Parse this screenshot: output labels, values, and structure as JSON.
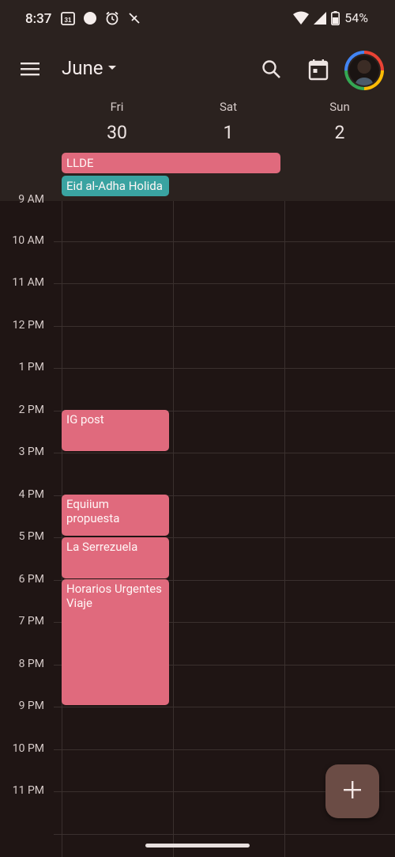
{
  "status_bar": {
    "time": "8:37",
    "calendar_icon_text": "31",
    "battery_text": "54%",
    "icons": [
      "calendar-icon",
      "dot-icon",
      "alarm-icon",
      "nfc-off-icon",
      "wifi-icon",
      "signal-icon",
      "battery-icon"
    ]
  },
  "header": {
    "month": "June",
    "icons": [
      "menu-icon",
      "dropdown-arrow-icon",
      "search-icon",
      "today-icon",
      "avatar"
    ]
  },
  "days": [
    {
      "name": "Fri",
      "num": "30"
    },
    {
      "name": "Sat",
      "num": "1"
    },
    {
      "name": "Sun",
      "num": "2"
    }
  ],
  "all_day_events": [
    {
      "title": "LLDE",
      "color": "#e06a7d"
    },
    {
      "title": "Eid al-Adha Holida",
      "color": "#3aa3a1"
    }
  ],
  "partial_hour_label": "9 AM",
  "hours": [
    "10 AM",
    "11 AM",
    "12 PM",
    "1 PM",
    "2 PM",
    "3 PM",
    "4 PM",
    "5 PM",
    "6 PM",
    "7 PM",
    "8 PM",
    "9 PM",
    "10 PM",
    "11 PM"
  ],
  "events": [
    {
      "title": "IG post",
      "color": "#e06a7d"
    },
    {
      "title": "Equiium propuesta",
      "color": "#e06a7d"
    },
    {
      "title": "La Serrezuela",
      "color": "#e06a7d"
    },
    {
      "title": "Horarios Urgentes Viaje",
      "color": "#e06a7d"
    }
  ],
  "fab": {
    "icon": "plus-icon"
  }
}
